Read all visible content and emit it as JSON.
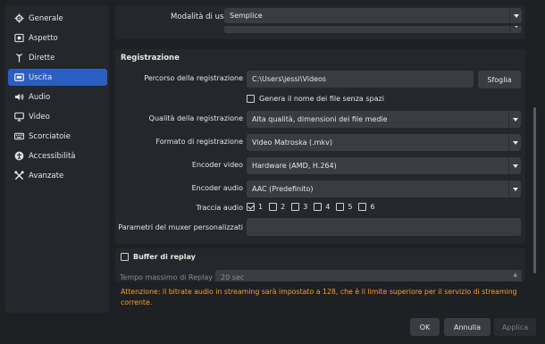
{
  "sidebar": {
    "items": [
      {
        "label": "Generale",
        "icon": "gear-icon",
        "active": false
      },
      {
        "label": "Aspetto",
        "icon": "appearance-icon",
        "active": false
      },
      {
        "label": "Dirette",
        "icon": "antenna-icon",
        "active": false
      },
      {
        "label": "Uscita",
        "icon": "output-icon",
        "active": true
      },
      {
        "label": "Audio",
        "icon": "speaker-icon",
        "active": false
      },
      {
        "label": "Video",
        "icon": "monitor-icon",
        "active": false
      },
      {
        "label": "Scorciatoie",
        "icon": "keyboard-icon",
        "active": false
      },
      {
        "label": "Accessibilità",
        "icon": "accessibility-icon",
        "active": false
      },
      {
        "label": "Avanzate",
        "icon": "tools-icon",
        "active": false
      }
    ]
  },
  "output_mode": {
    "label": "Modalità di uscita",
    "value": "Semplice"
  },
  "recording": {
    "title": "Registrazione",
    "path_label": "Percorso della registrazione",
    "path_value": "C:\\Users\\jessi\\Videos",
    "browse_label": "Sfoglia",
    "gen_name_label": "Genera il nome dei file senza spazi",
    "quality_label": "Qualità della registrazione",
    "quality_value": "Alta qualità, dimensioni dei file medie",
    "format_label": "Formato di registrazione",
    "format_value": "Video Matroska (.mkv)",
    "video_encoder_label": "Encoder video",
    "video_encoder_value": "Hardware (AMD, H.264)",
    "audio_encoder_label": "Encoder audio",
    "audio_encoder_value": "AAC (Predefinito)",
    "audio_track_label": "Traccia audio",
    "tracks": [
      "1",
      "2",
      "3",
      "4",
      "5",
      "6"
    ],
    "muxer_label": "Parametri del muxer personalizzati",
    "muxer_value": ""
  },
  "replay": {
    "title": "Buffer di replay",
    "max_time_label": "Tempo massimo di Replay",
    "max_time_value": "20 sec"
  },
  "warning": "Attenzione: il bitrate audio in streaming sarà impostato a 128, che è il limite superiore per il servizio di streaming corrente.",
  "buttons": {
    "ok": "OK",
    "cancel": "Annulla",
    "apply": "Applica"
  },
  "colors": {
    "accent": "#2a5fc1",
    "warning": "#f0a030",
    "background": "#1f2024",
    "panel": "#26272c"
  }
}
